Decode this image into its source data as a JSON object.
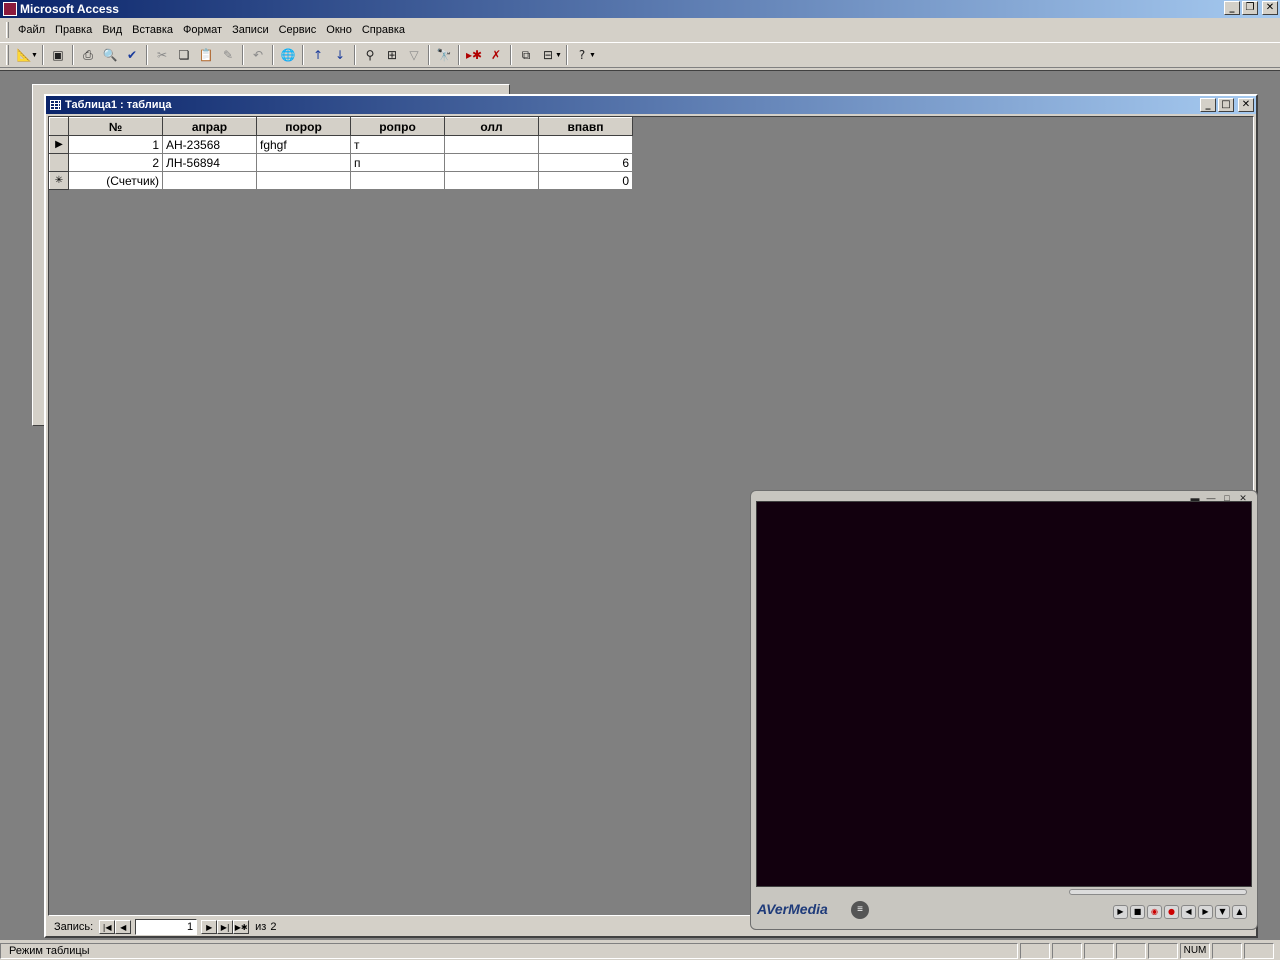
{
  "app": {
    "title": "Microsoft Access"
  },
  "menu": [
    {
      "label": "Файл"
    },
    {
      "label": "Правка"
    },
    {
      "label": "Вид"
    },
    {
      "label": "Вставка"
    },
    {
      "label": "Формат"
    },
    {
      "label": "Записи"
    },
    {
      "label": "Сервис"
    },
    {
      "label": "Окно"
    },
    {
      "label": "Справка"
    }
  ],
  "table_window": {
    "title": "Таблица1 : таблица"
  },
  "columns": [
    "№",
    "апрар",
    "порор",
    "ропро",
    "олл",
    "впавп"
  ],
  "rows": [
    {
      "selector": "▶",
      "values": [
        "1",
        "АН-23568",
        "fghgf",
        "т",
        "",
        ""
      ]
    },
    {
      "selector": "",
      "values": [
        "2",
        "ЛН-56894",
        "",
        "п",
        "",
        "6"
      ]
    },
    {
      "selector": "✳",
      "values": [
        "(Счетчик)",
        "",
        "",
        "",
        "",
        "0"
      ]
    }
  ],
  "navigation": {
    "label": "Запись:",
    "current": "1",
    "of_label": "из",
    "total": "2"
  },
  "player": {
    "brand": "AVerMedia"
  },
  "status": {
    "text": "Режим таблицы",
    "num": "NUM"
  },
  "colors": {
    "titlebar_start": "#0a246a",
    "titlebar_end": "#a6caf0",
    "mdi_background": "#808080",
    "player_screen": "#12000e"
  }
}
